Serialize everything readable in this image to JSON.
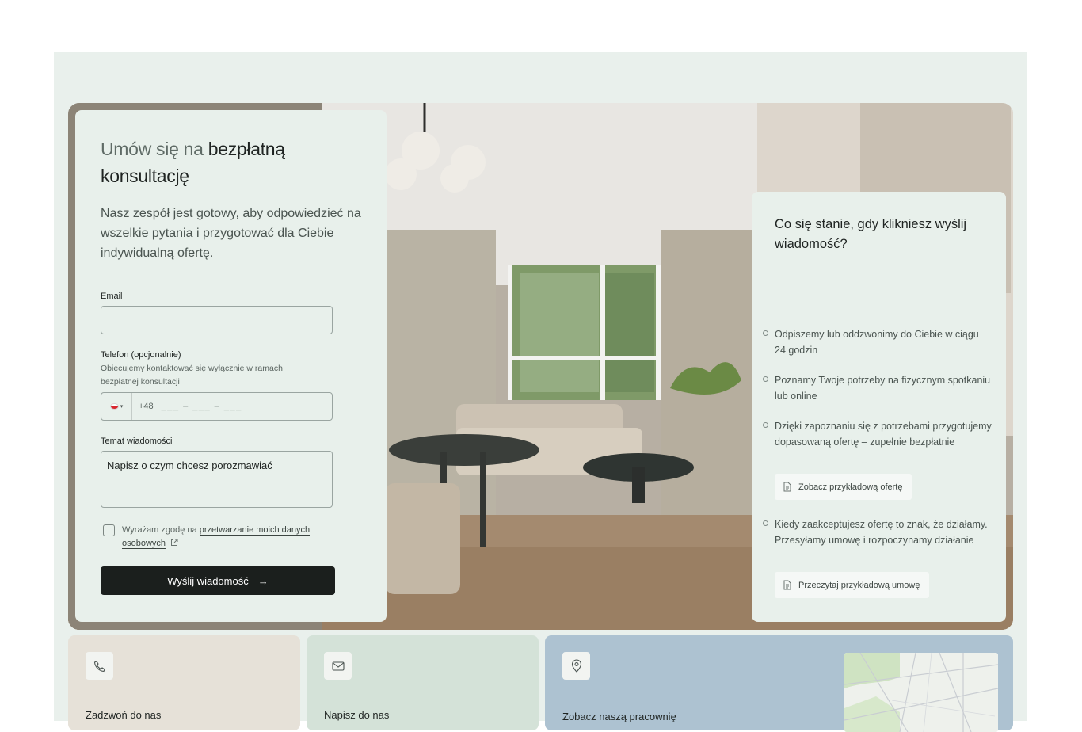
{
  "form": {
    "title_muted": "Umów się na",
    "title_strong": " bezpłatną konsultację",
    "lead": "Nasz zespół jest gotowy, aby odpowiedzieć na wszelkie pytania i przygotować dla Ciebie indywidualną ofertę.",
    "email_label": "Email",
    "email_value": "",
    "phone_label": "Telefon (opcjonalnie)",
    "phone_hint": "Obiecujemy kontaktować się wyłącznie w ramach bezpłatnej konsultacji",
    "phone_prefix": "+48",
    "phone_mask": "___ – ___ – ___",
    "subject_label": "Temat wiadomości",
    "subject_value": "Napisz o czym chcesz porozmawiać",
    "consent_text": "Wyrażam zgodę na ",
    "consent_link": "przetwarzanie moich danych osobowych",
    "submit_label": "Wyślij wiadomość"
  },
  "info": {
    "title": "Co się stanie, gdy klikniesz wyślij wiadomość?",
    "steps": [
      "Odpiszemy lub oddzwonimy do Ciebie w ciągu 24 godzin",
      "Poznamy Twoje potrzeby na fizycznym spotkaniu lub online",
      "Dzięki zapoznaniu się z potrzebami przygotujemy dopasowaną ofertę – zupełnie bezpłatnie",
      "Kiedy zaakceptujesz ofertę to znak, że działamy. Przesyłamy umowę i rozpoczynamy działanie"
    ],
    "offer_button": "Zobacz przykładową ofertę",
    "contract_button": "Przeczytaj przykładową umowę"
  },
  "tiles": {
    "call": "Zadzwoń do nas",
    "write": "Napisz do nas",
    "visit": "Zobacz naszą pracownię"
  },
  "colors": {
    "page_bg": "#e9f0ec",
    "card_bg": "#e8f0eb",
    "button_dark": "#1b1f1d",
    "tile_call": "#e6e1d8",
    "tile_write": "#d4e2d8",
    "tile_visit": "#adc2d1"
  },
  "icons": [
    "phone-icon",
    "mail-icon",
    "location-pin-icon",
    "document-icon",
    "arrow-right-icon",
    "external-link-icon",
    "flag-pl-icon"
  ]
}
